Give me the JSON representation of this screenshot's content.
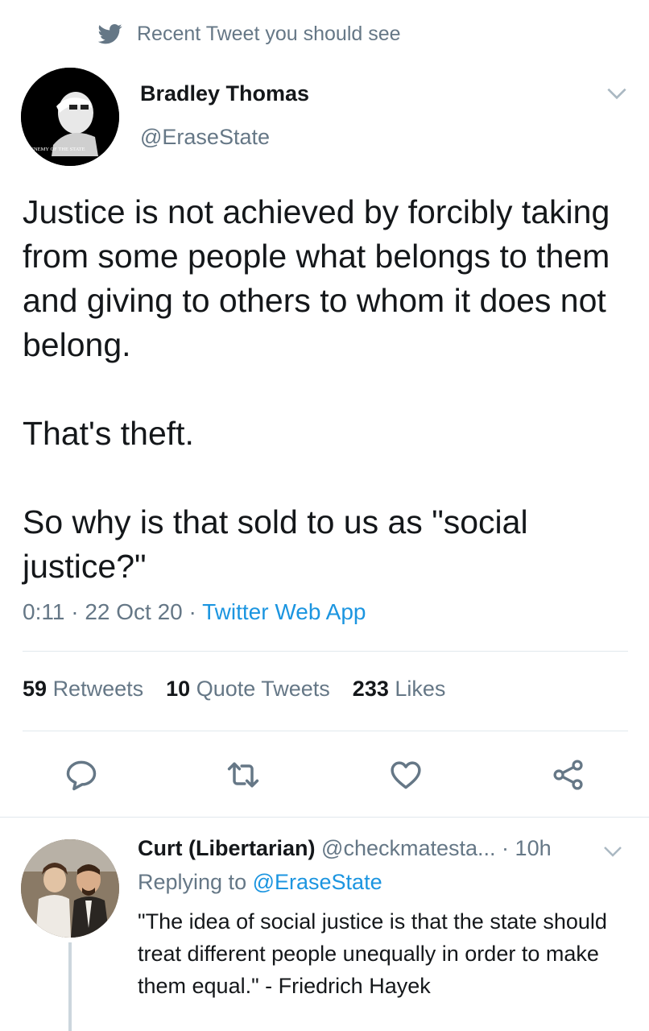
{
  "context": {
    "icon": "twitter-bird-icon",
    "text": "Recent Tweet you should see"
  },
  "tweet": {
    "author": {
      "name": "Bradley Thomas",
      "handle": "@EraseState",
      "avatar_caption": "ENEMY OF THE STATE"
    },
    "paragraphs": [
      "Justice is not achieved by forcibly taking from some people what belongs to them and giving to others to whom it does not belong.",
      "That's theft.",
      "So why is that sold to us as \"social justice?\""
    ],
    "time": "0:11",
    "date": "22 Oct 20",
    "source": "Twitter Web App",
    "stats": {
      "retweets_count": "59",
      "retweets_label": "Retweets",
      "quotes_count": "10",
      "quotes_label": "Quote Tweets",
      "likes_count": "233",
      "likes_label": "Likes"
    }
  },
  "reply": {
    "name": "Curt (Libertarian)",
    "handle": "@checkmatesta...",
    "time": "10h",
    "replying_prefix": "Replying to",
    "replying_to": "@EraseState",
    "text": "\"The idea of social justice is that the state should treat different people unequally in order to make them equal.\" - Friedrich Hayek"
  },
  "colors": {
    "accent": "#1b95e0",
    "secondary_text": "#657786",
    "divider": "#e1e8ed"
  }
}
